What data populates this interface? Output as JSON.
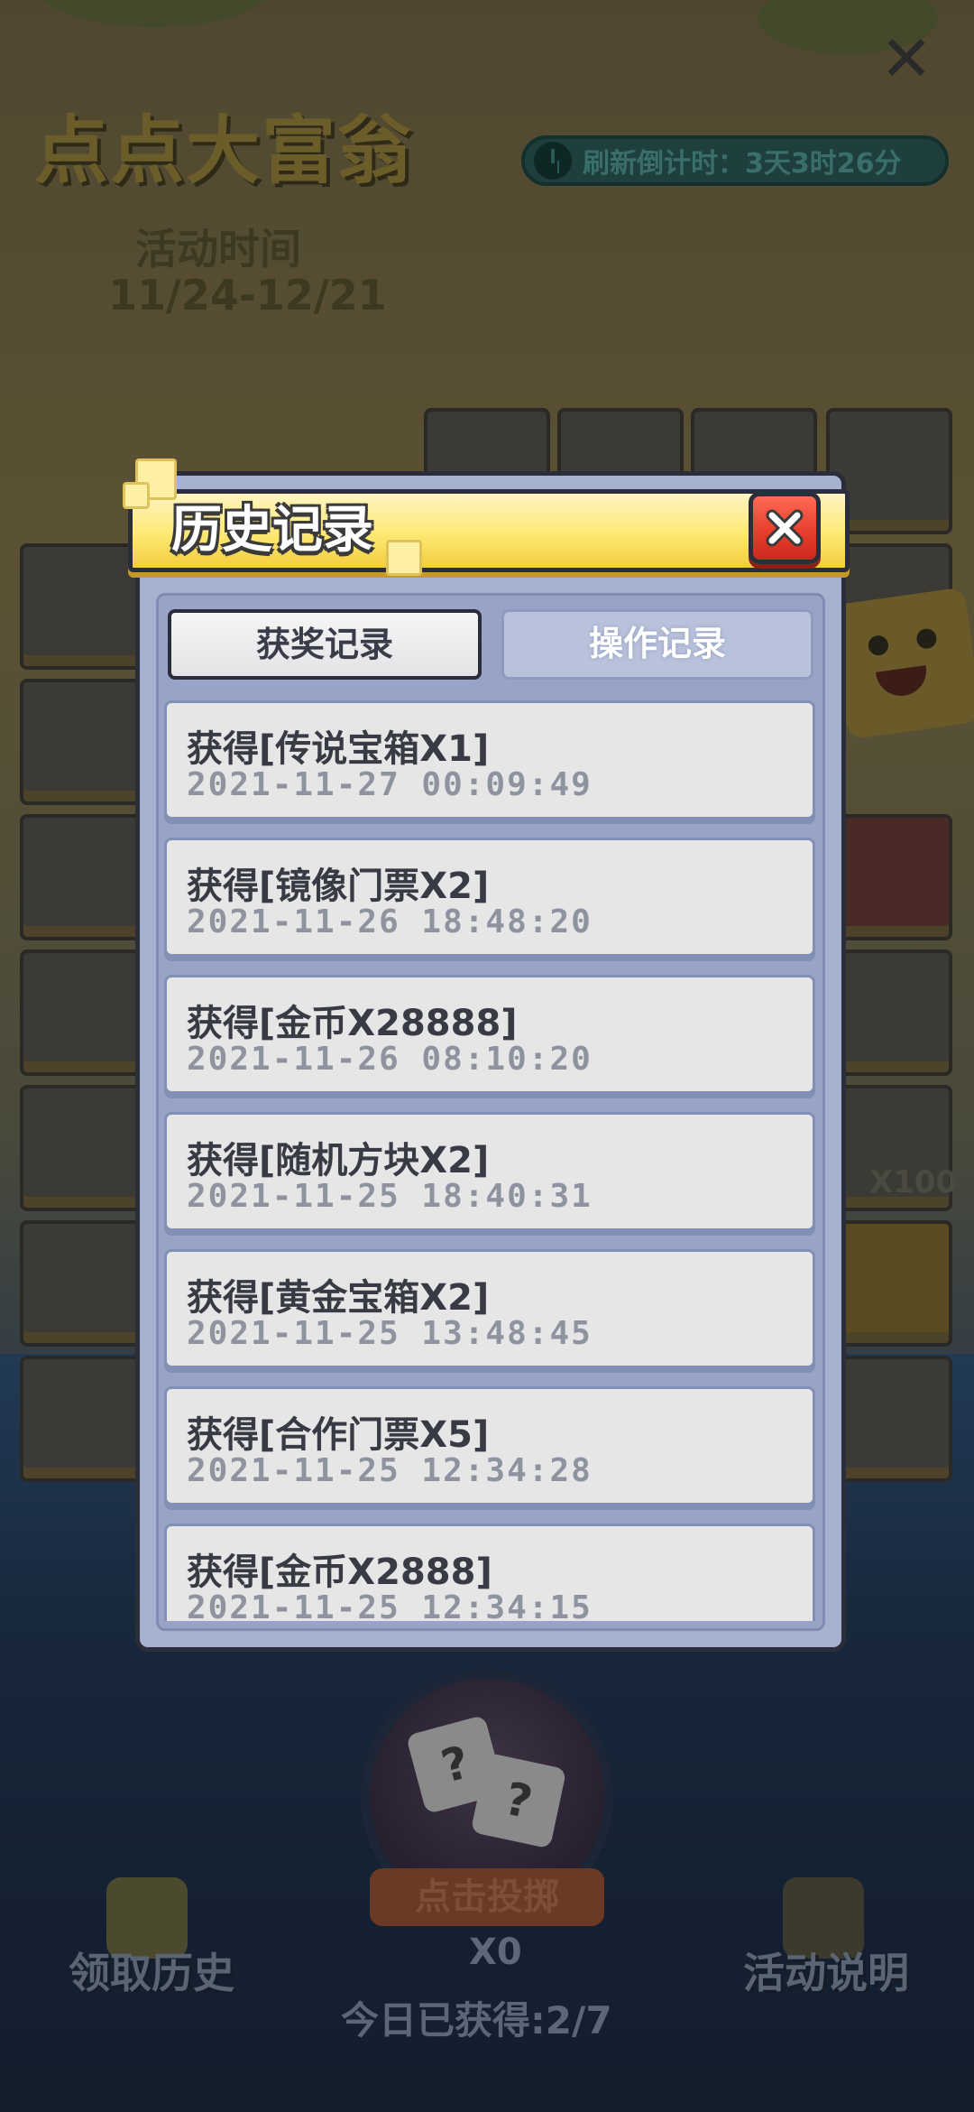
{
  "background": {
    "game_title": "点点大富翁",
    "event_time_label": "活动时间",
    "event_time_range": "11/24-12/21",
    "countdown_text": "刷新倒计时：3天3时26分",
    "tile_labels": [
      "X100"
    ],
    "roll_button_label": "点击投掷",
    "roll_count": "X0",
    "claim_history_label": "领取历史",
    "event_info_label": "活动说明",
    "today_obtained": "今日已获得:2/7"
  },
  "modal": {
    "title": "历史记录",
    "tabs": [
      {
        "label": "获奖记录",
        "active": true
      },
      {
        "label": "操作记录",
        "active": false
      }
    ],
    "records": [
      {
        "title": "获得[传说宝箱X1]",
        "time": "2021-11-27  00:09:49"
      },
      {
        "title": "获得[镜像门票X2]",
        "time": "2021-11-26  18:48:20"
      },
      {
        "title": "获得[金币X28888]",
        "time": "2021-11-26  08:10:20"
      },
      {
        "title": "获得[随机方块X2]",
        "time": "2021-11-25  18:40:31"
      },
      {
        "title": "获得[黄金宝箱X2]",
        "time": "2021-11-25  13:48:45"
      },
      {
        "title": "获得[合作门票X5]",
        "time": "2021-11-25  12:34:28"
      },
      {
        "title": "获得[金币X2888]",
        "time": "2021-11-25  12:34:15"
      }
    ]
  },
  "colors": {
    "banner_yellow": "#ffe873",
    "close_red": "#e63b2b",
    "panel_blue": "#a6b1cf",
    "card_gray": "#e6e6e6"
  }
}
